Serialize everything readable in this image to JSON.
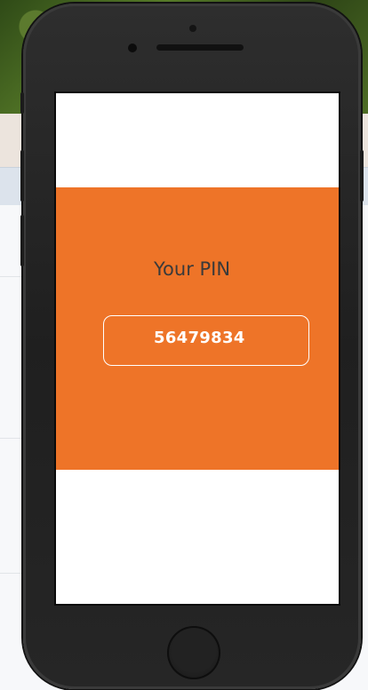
{
  "pin": {
    "label": "Your PIN",
    "value": "56479834"
  },
  "colors": {
    "accent": "#ee7428",
    "label_text": "#3a3a3a",
    "value_text": "#ffffff",
    "phone_body": "#262626"
  },
  "icons": {
    "home": "home-button-icon",
    "camera": "camera-icon",
    "speaker": "speaker-icon"
  }
}
